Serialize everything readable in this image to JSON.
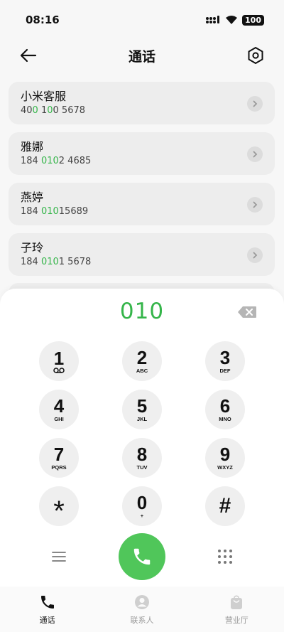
{
  "status": {
    "time": "08:16",
    "battery": "100"
  },
  "header": {
    "title": "通话"
  },
  "calls": [
    {
      "name": "小米客服",
      "number": [
        {
          "t": "40",
          "hl": false
        },
        {
          "t": "0",
          "hl": true
        },
        {
          "t": " 1",
          "hl": false
        },
        {
          "t": "0",
          "hl": true
        },
        {
          "t": "0 5678",
          "hl": false
        }
      ]
    },
    {
      "name": "雅娜",
      "number": [
        {
          "t": "184 ",
          "hl": false
        },
        {
          "t": "010",
          "hl": true
        },
        {
          "t": "2 4685",
          "hl": false
        }
      ]
    },
    {
      "name": "燕婷",
      "number": [
        {
          "t": "184 ",
          "hl": false
        },
        {
          "t": "010",
          "hl": true
        },
        {
          "t": "15689",
          "hl": false
        }
      ]
    },
    {
      "name": "子玲",
      "number": [
        {
          "t": "184 ",
          "hl": false
        },
        {
          "t": "010",
          "hl": true
        },
        {
          "t": "1 5678",
          "hl": false
        }
      ]
    }
  ],
  "dialer": {
    "display": "010"
  },
  "keys": [
    {
      "digit": "1",
      "letters": ""
    },
    {
      "digit": "2",
      "letters": "ABC"
    },
    {
      "digit": "3",
      "letters": "DEF"
    },
    {
      "digit": "4",
      "letters": "GHI"
    },
    {
      "digit": "5",
      "letters": "JKL"
    },
    {
      "digit": "6",
      "letters": "MNO"
    },
    {
      "digit": "7",
      "letters": "PQRS"
    },
    {
      "digit": "8",
      "letters": "TUV"
    },
    {
      "digit": "9",
      "letters": "WXYZ"
    },
    {
      "digit": "*",
      "letters": ""
    },
    {
      "digit": "0",
      "letters": "+"
    },
    {
      "digit": "#",
      "letters": ""
    }
  ],
  "tabs": [
    {
      "label": "通话",
      "active": true
    },
    {
      "label": "联系人",
      "active": false
    },
    {
      "label": "营业厅",
      "active": false
    }
  ],
  "colors": {
    "accent_green": "#35b54a",
    "call_button": "#50c65a",
    "card_bg": "#ededed"
  },
  "icons": {
    "back": "arrow-left-icon",
    "settings": "hexagon-settings-icon",
    "voicemail": "voicemail-icon",
    "backspace": "backspace-icon",
    "menu": "hamburger-icon",
    "grid": "dialpad-grid-icon",
    "call": "phone-icon",
    "contacts": "person-icon",
    "store": "bag-icon"
  }
}
